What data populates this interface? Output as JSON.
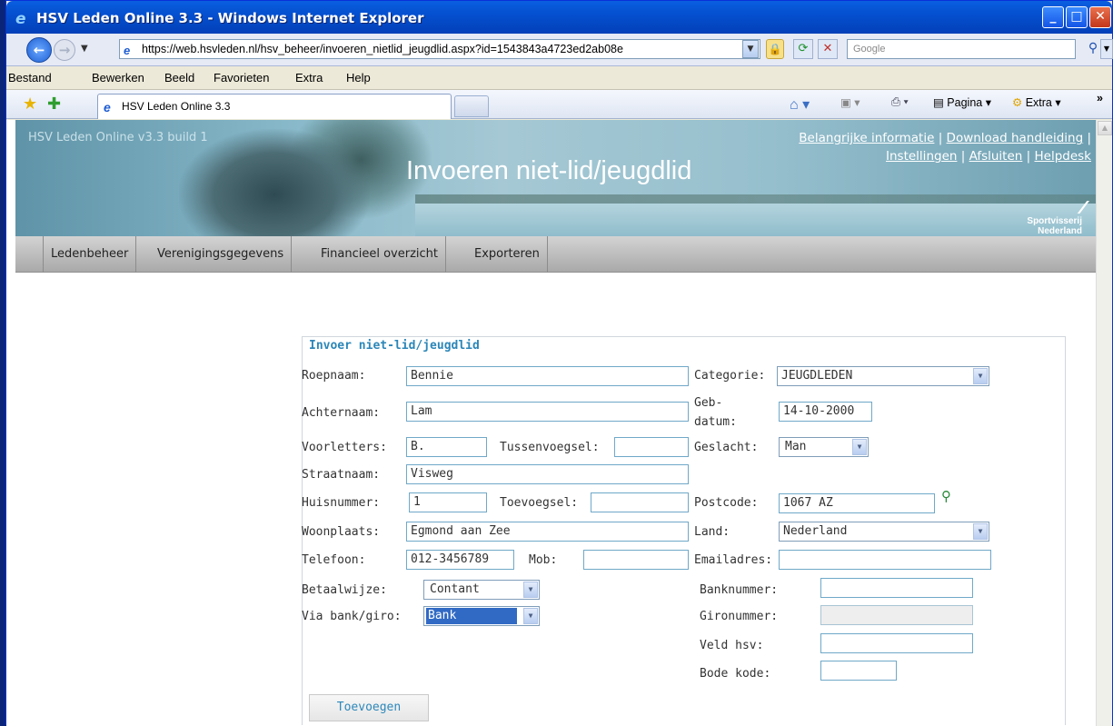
{
  "window": {
    "title": "HSV Leden Online 3.3 - Windows Internet Explorer"
  },
  "address": {
    "url": "https://web.hsvleden.nl/hsv_beheer/invoeren_nietlid_jeugdlid.aspx?id=1543843a4723ed2ab08e",
    "search_placeholder": "Google"
  },
  "menu": {
    "items": [
      "Bestand",
      "Bewerken",
      "Beeld",
      "Favorieten",
      "Extra",
      "Help"
    ]
  },
  "toolbar": {
    "tab_label": "HSV Leden Online 3.3",
    "pagina": "Pagina",
    "extra": "Extra"
  },
  "header": {
    "version": "HSV Leden Online v3.3 build 1",
    "title": "Invoeren niet-lid/jeugdlid",
    "links": [
      "Belangrijke informatie",
      "Download handleiding",
      "Instellingen",
      "Afsluiten",
      "Helpdesk"
    ],
    "sponsor_line1": "Sportvisserij",
    "sponsor_line2": "Nederland"
  },
  "nav": {
    "tabs": [
      "Ledenbeheer",
      "Verenigingsgegevens",
      "Financieel overzicht",
      "Exporteren"
    ]
  },
  "form": {
    "title": "Invoer niet-lid/jeugdlid",
    "labels": {
      "roepnaam": "Roepnaam:",
      "achternaam": "Achternaam:",
      "voorletters": "Voorletters:",
      "tussenvoegsel": "Tussenvoegsel:",
      "straatnaam": "Straatnaam:",
      "huisnummer": "Huisnummer:",
      "toevoegsel": "Toevoegsel:",
      "woonplaats": "Woonplaats:",
      "telefoon": "Telefoon:",
      "mob": "Mob:",
      "betaalwijze": "Betaalwijze:",
      "via_bank": "Via bank/giro:",
      "categorie": "Categorie:",
      "geb_1": "Geb-",
      "geb_2": "datum:",
      "geslacht": "Geslacht:",
      "postcode": "Postcode:",
      "land": "Land:",
      "email": "Emailadres:",
      "banknummer": "Banknummer:",
      "gironummer": "Gironummer:",
      "veld_hsv": "Veld hsv:",
      "bode_kode": "Bode kode:"
    },
    "values": {
      "roepnaam": "Bennie",
      "achternaam": "Lam",
      "voorletters": "B.",
      "tussenvoegsel": "",
      "straatnaam": "Visweg",
      "huisnummer": "1",
      "toevoegsel": "",
      "woonplaats": "Egmond aan Zee",
      "telefoon": "012-3456789",
      "mob": "",
      "betaalwijze": "Contant",
      "via_bank": "Bank",
      "categorie": "JEUGDLEDEN",
      "gebdatum": "14-10-2000",
      "geslacht": "Man",
      "postcode": "1067 AZ",
      "land": "Nederland",
      "email": "",
      "banknummer": "",
      "gironummer": "",
      "veld_hsv": "",
      "bode_kode": ""
    },
    "submit": "Toevoegen"
  }
}
